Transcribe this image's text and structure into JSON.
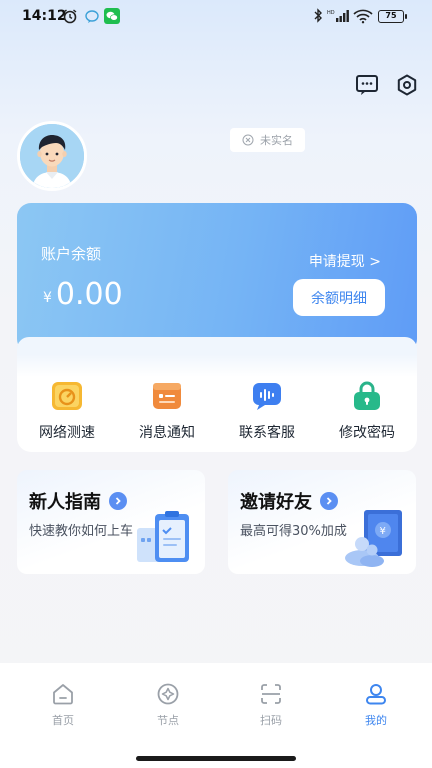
{
  "status_bar": {
    "time": "14:12",
    "battery": "75"
  },
  "profile": {
    "realname_status": "未实名"
  },
  "balance": {
    "label": "账户余额",
    "currency": "¥",
    "amount": "0.00",
    "withdraw_link": "申请提现 >",
    "detail_button": "余额明细"
  },
  "actions": [
    {
      "label": "网络测速",
      "icon": "speedometer-icon",
      "color": "#f5b731"
    },
    {
      "label": "消息通知",
      "icon": "message-card-icon",
      "color": "#f08a3c"
    },
    {
      "label": "联系客服",
      "icon": "voice-chat-icon",
      "color": "#3e7ff0"
    },
    {
      "label": "修改密码",
      "icon": "lock-icon",
      "color": "#27b98a"
    }
  ],
  "promos": [
    {
      "title": "新人指南",
      "subtitle": "快速教你如何上车"
    },
    {
      "title": "邀请好友",
      "subtitle": "最高可得30%加成"
    }
  ],
  "tabs": [
    {
      "label": "首页",
      "icon": "home-icon",
      "active": false
    },
    {
      "label": "节点",
      "icon": "node-icon",
      "active": false
    },
    {
      "label": "扫码",
      "icon": "scan-icon",
      "active": false
    },
    {
      "label": "我的",
      "icon": "profile-icon",
      "active": true
    }
  ],
  "colors": {
    "accent": "#3e86ef",
    "card_gradient_start": "#8cc7f3",
    "card_gradient_end": "#5f9cf6"
  }
}
